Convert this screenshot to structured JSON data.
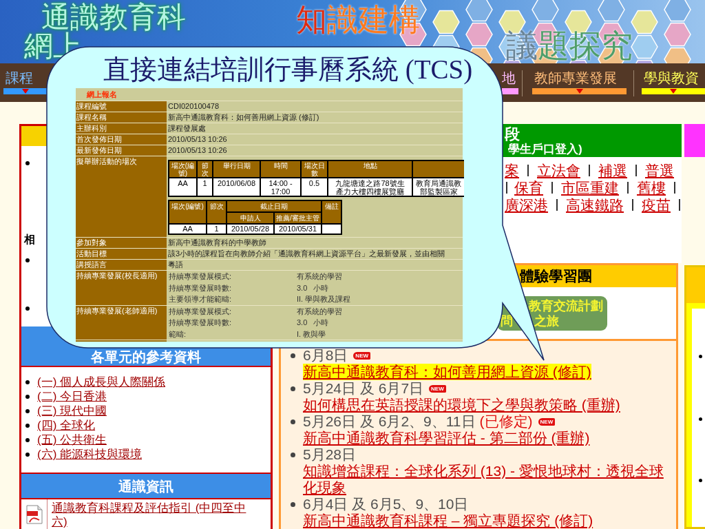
{
  "banner": {
    "title_lines": [
      "通識教育科",
      "網上"
    ],
    "slogans": [
      "知識建構",
      "議題探究"
    ]
  },
  "nav": [
    {
      "label": "課程",
      "color": "#3399ff",
      "caret": true
    },
    {
      "label": "地",
      "color": "#ff99ff",
      "caret": false
    },
    {
      "label": "教師專業發展",
      "color": "#ff9933",
      "caret": true
    },
    {
      "label": "學與教資",
      "color": "#ffff00",
      "caret": true
    }
  ],
  "callout": {
    "title": "直接連結培訓行事曆系統 (TCS)",
    "form": {
      "heading": "網上報名",
      "rows": [
        {
          "kind": "text",
          "label": "課程編號",
          "value": "CDI020100478"
        },
        {
          "kind": "text",
          "label": "課程名稱",
          "value": "新高中通識教育科：如何善用網上資源 (修訂)"
        },
        {
          "kind": "text",
          "label": "主辦科別",
          "value": "課程發展處"
        },
        {
          "kind": "text",
          "label": "首次發佈日期",
          "value": "2010/05/13 10:26"
        },
        {
          "kind": "text",
          "label": "最新發佈日期",
          "value": "2010/05/13 10:26"
        },
        {
          "kind": "sessions",
          "label": "擬舉辦活動的場次",
          "sessions": {
            "columns": [
              "場次(編號)",
              "節次",
              "舉行日期",
              "時間",
              "場次日數",
              "地點"
            ],
            "rows": [
              [
                "AA",
                "1",
                "2010/06/08",
                "14:00 - 17:00",
                "0.5",
                "九龍塘達之路78號生產力大樓四樓展覽廳",
                "教育局通識教部監製區家"
              ]
            ]
          },
          "deadlines": {
            "columns": [
              "場次(編號)",
              "節次"
            ],
            "group": "截止日期",
            "group_columns": [
              "申請人",
              "推薦/審批主管"
            ],
            "remark_column": "備註",
            "rows": [
              [
                "AA",
                "1",
                "2010/05/28",
                "2010/05/31"
              ]
            ]
          }
        },
        {
          "kind": "text",
          "label": "參加對象",
          "value": "新高中通識教育科的中學教師"
        },
        {
          "kind": "text",
          "label": "活動目標",
          "value": "該3小時的課程旨在向教師介紹「通識教育科網上資源平台」之最新發展，並由相關"
        },
        {
          "kind": "text",
          "label": "講授語言",
          "value": "粵語"
        },
        {
          "kind": "pairs",
          "label": "持續專業發展(校長適用)",
          "pairs": [
            [
              "持續專業發展模式:",
              "有系統的學習"
            ],
            [
              "持續專業發展時數:",
              "3.0   小時"
            ],
            [
              "主要領導才能範疇:",
              "II. 學與教及課程"
            ]
          ]
        },
        {
          "kind": "pairs",
          "label": "持續專業發展(老師適用)",
          "pairs": [
            [
              "持續專業發展模式:",
              "有系統的學習"
            ],
            [
              "持續專業發展時數:",
              "3.0   小時"
            ],
            [
              "範疇:",
              "I. 教與學"
            ]
          ]
        }
      ]
    }
  },
  "left_panel": {
    "fragments": [
      {
        "kind": "bullet"
      },
      {
        "kind": "heading",
        "text": "相"
      },
      {
        "kind": "bullet"
      },
      {
        "kind": "bullet"
      }
    ],
    "units_heading": "各單元的參考資料",
    "units": [
      "(一) 個人成長與人際關係",
      "(二) 今日香港",
      "(三) 現代中國",
      "(四) 全球化",
      "(五) 公共衛生",
      "(六) 能源科技與環境"
    ],
    "info_heading": "通識資訊",
    "info_items": [
      {
        "kind": "pdf",
        "label": "通識教育科課程及評估指引 (中四至中六)"
      }
    ]
  },
  "student_panel": {
    "title": "段",
    "subtitle": "學生戶口登入)",
    "topic_lines": [
      {
        "links": [
          "案",
          "立法會",
          "補選",
          "普選"
        ]
      },
      {
        "leading_divider": true,
        "links": [
          "保育",
          "市區重建",
          "舊樓"
        ],
        "trailing_divider": true
      },
      {
        "links": [
          "廣深港",
          "高速鐵路",
          "疫苗"
        ],
        "trailing_divider": true
      }
    ]
  },
  "programmes": {
    "heading": "體驗學習團",
    "banner": {
      "line_1": "教育交流計劃",
      "line_2": [
        "問",
        "之旅"
      ]
    },
    "events": [
      {
        "date": "6月8日",
        "badge": "NEW",
        "link": "新高中通識教育科：如何善用網上資源 (修訂)",
        "highlighted": true
      },
      {
        "date": "5月24日 及 6月7日",
        "badge": "NEW",
        "link": "如何構思在英語授課的環境下之學與教策略 (重辦)",
        "highlighted": false
      },
      {
        "date": "5月26日 及 6月2、9、11日",
        "note": "(已修定)",
        "badge": "NEW",
        "link": "新高中通識教育科學習評估 - 第二部份 (重辦)",
        "highlighted": false
      },
      {
        "date": "5月28日",
        "link": "知識增益課程：全球化系列 (13) - 愛恨地球村：透視全球化現象",
        "highlighted": false
      },
      {
        "date": "6月4日 及 6月5、9、10日",
        "link": "新高中通識教育科課程 – 獨立專題探究 (修訂)",
        "highlighted": false
      }
    ]
  }
}
